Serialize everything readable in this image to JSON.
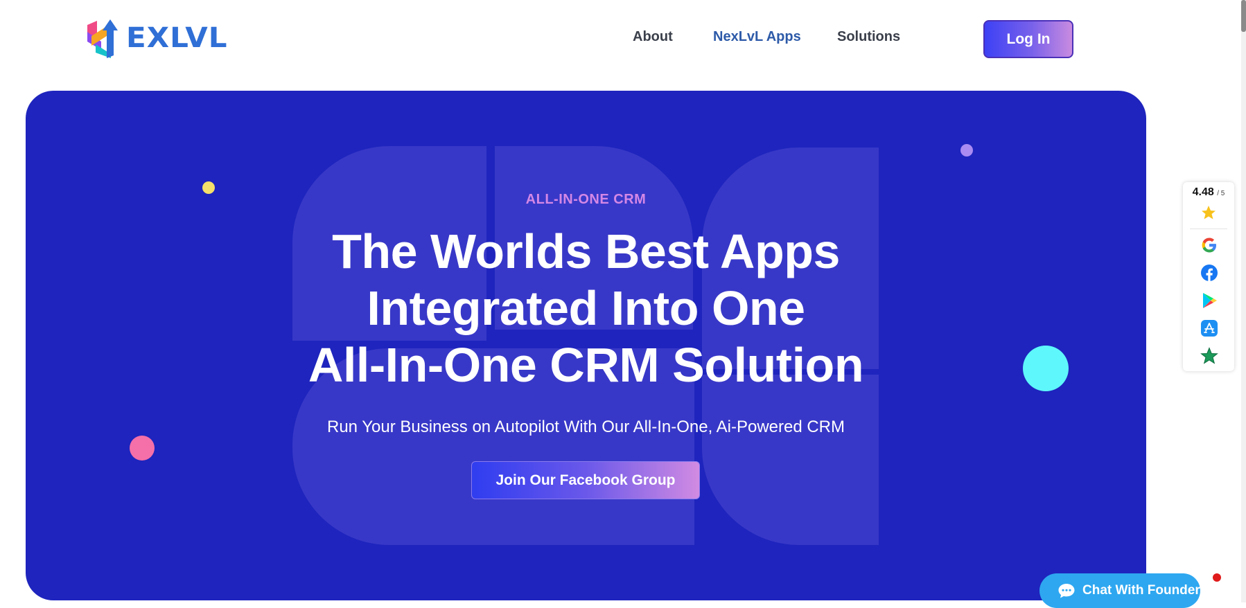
{
  "header": {
    "logo_text": "EXLVL",
    "nav": [
      {
        "label": "About"
      },
      {
        "label": "NexLvL Apps"
      },
      {
        "label": "Solutions"
      }
    ],
    "login_label": "Log In"
  },
  "hero": {
    "eyebrow": "ALL-IN-ONE CRM",
    "headline": [
      "The Worlds Best Apps",
      "Integrated Into One",
      "All-In-One CRM Solution"
    ],
    "subline": "Run Your Business on Autopilot With Our All-In-One, Ai-Powered CRM",
    "cta_label": "Join Our Facebook Group"
  },
  "rating": {
    "score": "4.48",
    "out_of": "/ 5",
    "icons": [
      "star-icon",
      "google-icon",
      "facebook-icon",
      "google-play-icon",
      "app-store-icon",
      "trustpilot-icon"
    ]
  },
  "chat": {
    "label": "Chat With Founder",
    "icon": "chat-bubble-icon"
  },
  "colors": {
    "hero_bg": "#1e24bd",
    "accent_gradient_start": "#3d41f5",
    "accent_gradient_end": "#c98be0",
    "eyebrow": "#d488e6",
    "chat": "#2ea7f0"
  }
}
